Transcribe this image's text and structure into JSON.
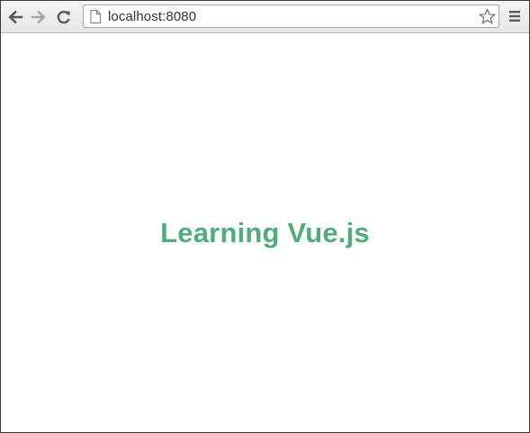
{
  "browser": {
    "address_bar": {
      "host": "localhost",
      "port_suffix": ":8080"
    },
    "icons": {
      "back": "back-arrow-icon",
      "forward": "forward-arrow-icon",
      "reload": "reload-icon",
      "page": "page-icon",
      "bookmark": "bookmark-star-icon",
      "menu": "menu-icon"
    }
  },
  "page": {
    "heading": "Learning Vue.js",
    "heading_color": "#4fae7b"
  }
}
